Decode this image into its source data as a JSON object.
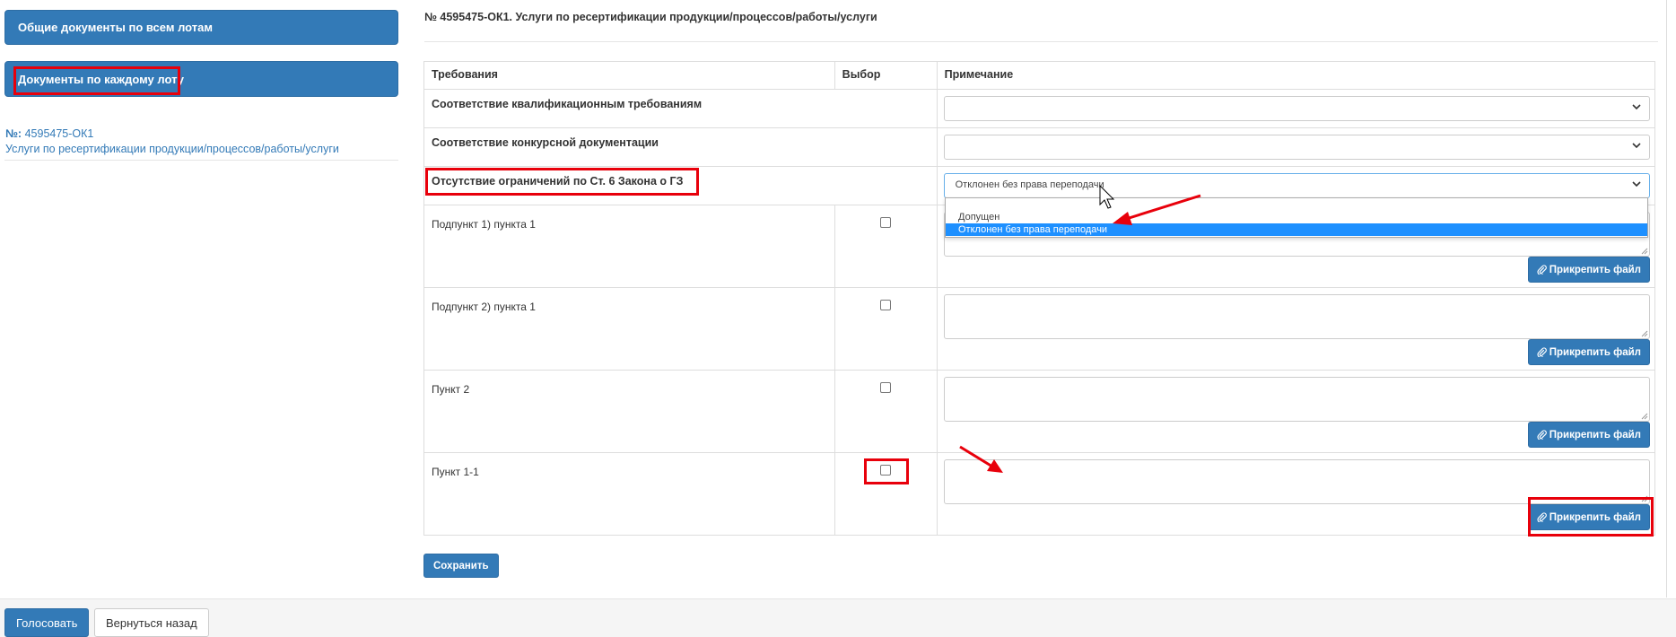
{
  "sidebar": {
    "common_docs_label": "Общие документы по всем лотам",
    "per_lot_docs_label": "Документы по каждому лоту",
    "lot_number_prefix": "№:",
    "lot_number": "4595475-ОК1",
    "lot_name": "Услуги по ресертификации продукции/процессов/работы/услуги"
  },
  "main": {
    "title": "№ 4595475-ОК1. Услуги по ресертификации продукции/процессов/работы/услуги",
    "table": {
      "headers": [
        "Требования",
        "Выбор",
        "Примечание"
      ],
      "groups": [
        {
          "label": "Соответствие квалификационным требованиям",
          "selected": ""
        },
        {
          "label": "Соответствие конкурсной документации",
          "selected": ""
        },
        {
          "label": "Отсутствие ограничений по Ст. 6 Закона о ГЗ",
          "selected": "Отклонен без права переподачи"
        }
      ],
      "subitems": [
        {
          "label": "Подпункт 1) пункта 1",
          "checked": false
        },
        {
          "label": "Подпункт 2) пункта 1",
          "checked": false
        },
        {
          "label": "Пункт 2",
          "checked": false
        },
        {
          "label": "Пункт 1-1",
          "checked": false
        }
      ],
      "attach_label": "Прикрепить файл"
    },
    "dropdown_options": [
      "Допущен",
      "Отклонен без права переподачи"
    ],
    "dropdown_highlighted": "Отклонен без права переподачи",
    "save_label": "Сохранить"
  },
  "footer": {
    "vote_label": "Голосовать",
    "back_label": "Вернуться назад"
  },
  "colors": {
    "primary": "#337ab7",
    "annotation_red": "#e8000b",
    "dropdown_highlight": "#1e90ff"
  },
  "icons": [
    "chevron-down-icon",
    "paperclip-icon",
    "mouse-cursor-icon",
    "resize-grip-icon",
    "arrow-annotation"
  ]
}
